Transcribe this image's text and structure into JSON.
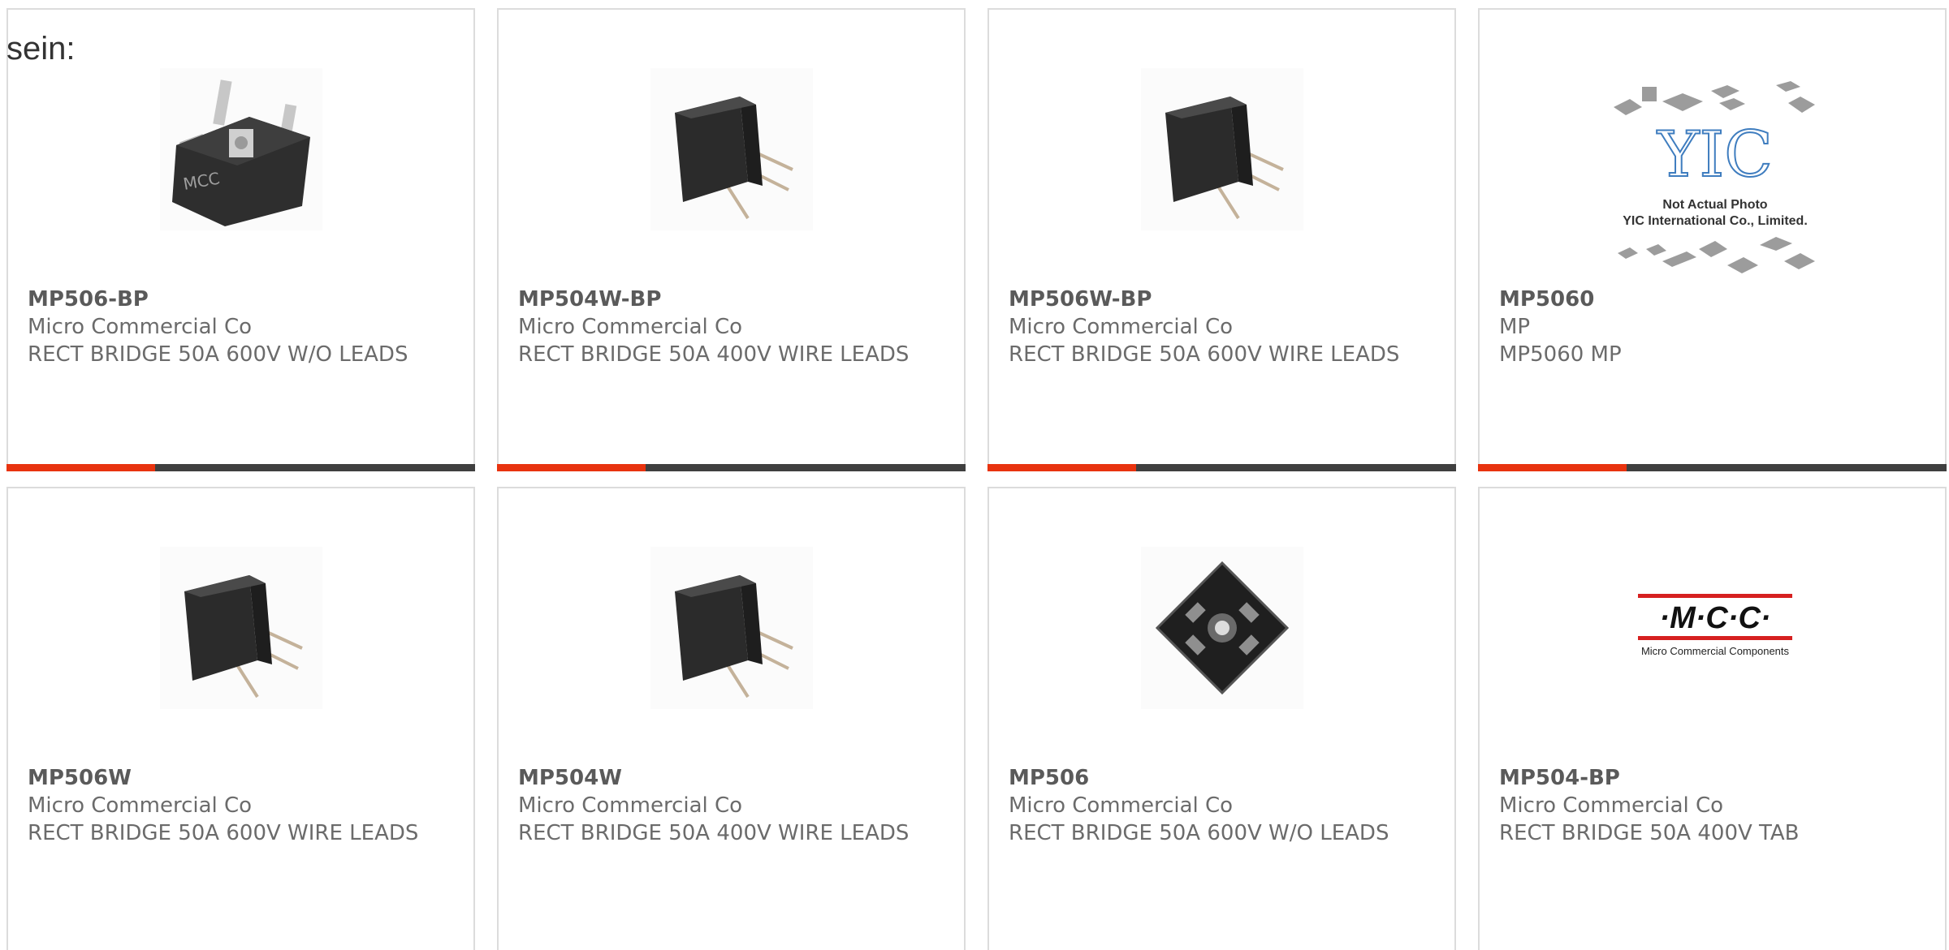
{
  "intro_text": "sein:",
  "products": [
    {
      "part": "MP506-BP",
      "maker": "Micro Commercial Co",
      "desc": "RECT BRIDGE 50A 600V W/O LEADS",
      "image": "bridge-rectifier-tab-icon"
    },
    {
      "part": "MP504W-BP",
      "maker": "Micro Commercial Co",
      "desc": "RECT BRIDGE 50A 400V WIRE LEADS",
      "image": "bridge-rectifier-wire-icon"
    },
    {
      "part": "MP506W-BP",
      "maker": "Micro Commercial Co",
      "desc": "RECT BRIDGE 50A 600V WIRE LEADS",
      "image": "bridge-rectifier-wire-icon"
    },
    {
      "part": "MP5060",
      "maker": "MP",
      "desc": "MP5060 MP",
      "image": "yic-placeholder-icon",
      "placeholder_lines": [
        "Not Actual Photo",
        "YIC International Co., Limited."
      ],
      "logo_text": "YIC"
    },
    {
      "part": "MP506W",
      "maker": "Micro Commercial Co",
      "desc": "RECT BRIDGE 50A 600V WIRE LEADS",
      "image": "bridge-rectifier-wire-icon"
    },
    {
      "part": "MP504W",
      "maker": "Micro Commercial Co",
      "desc": "RECT BRIDGE 50A 400V WIRE LEADS",
      "image": "bridge-rectifier-wire-icon"
    },
    {
      "part": "MP506",
      "maker": "Micro Commercial Co",
      "desc": "RECT BRIDGE 50A 600V W/O LEADS",
      "image": "bridge-rectifier-top-icon"
    },
    {
      "part": "MP504-BP",
      "maker": "Micro Commercial Co",
      "desc": "RECT BRIDGE 50A 400V TAB",
      "image": "mcc-logo-icon",
      "logo_text": "·M·C·C·",
      "logo_subtext": "Micro Commercial Components"
    }
  ],
  "colors": {
    "accent": "#e8330f",
    "bar": "#3f3f3f",
    "border": "#dcdcdc",
    "text": "#6b6b6b"
  }
}
